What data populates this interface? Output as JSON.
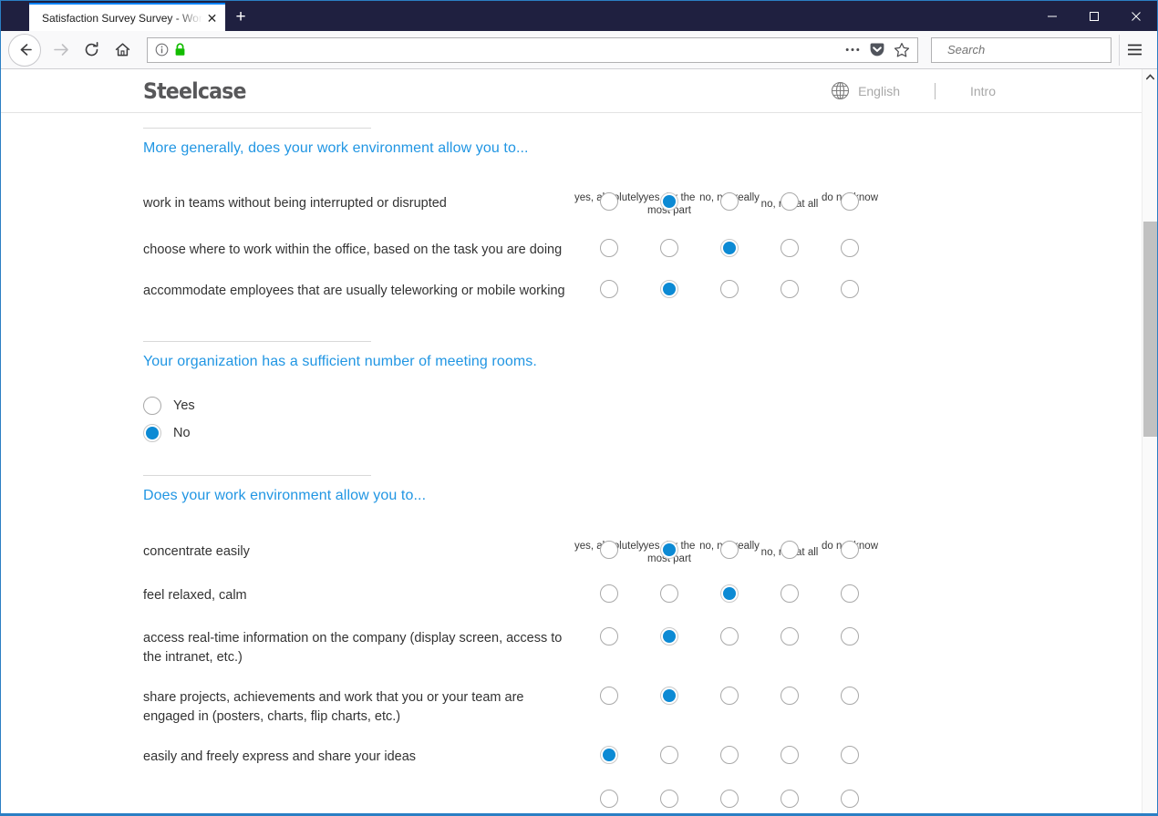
{
  "browser": {
    "tab_title": "Satisfaction Survey Survey - Workpl",
    "tab_close_glyph": "✕",
    "new_tab_glyph": "+",
    "url_value": "",
    "search_placeholder": "Search",
    "search_value": ""
  },
  "site": {
    "logo_text": "Steelcase",
    "language_label": "English",
    "intro_label": "Intro"
  },
  "colors": {
    "accent_blue": "#2196e3",
    "radio_fill": "#0c8ad4",
    "titlebar": "#1f2040",
    "window_border": "#2b7fc4",
    "logo_gray": "#58585a",
    "muted_gray": "#a8a8a8"
  },
  "scale_options": [
    "yes, absolutely",
    "yes, for the most part",
    "no, not really",
    "no, not at all",
    "do not know"
  ],
  "sections": [
    {
      "id": "more-generally",
      "type": "matrix",
      "title": "More generally, does your work environment allow you to...",
      "rows": [
        {
          "label": "work in teams without being interrupted or disrupted",
          "selected": 1
        },
        {
          "label": "choose where to work within the office, based on the task you are doing",
          "selected": 2
        },
        {
          "label": "accommodate employees that are usually teleworking or mobile working",
          "selected": 1
        }
      ]
    },
    {
      "id": "meeting-rooms",
      "type": "yesno",
      "title": "Your organization has a sufficient number of meeting rooms.",
      "options": [
        {
          "label": "Yes",
          "selected": false
        },
        {
          "label": "No",
          "selected": true
        }
      ]
    },
    {
      "id": "does-allow",
      "type": "matrix",
      "title": "Does your work environment allow you to...",
      "rows": [
        {
          "label": "concentrate easily",
          "selected": 1
        },
        {
          "label": "feel relaxed, calm",
          "selected": 2
        },
        {
          "label": "access real-time information on the company (display screen, access to the intranet, etc.)",
          "selected": 1
        },
        {
          "label": "share projects, achievements and work that you or your team are engaged in (posters, charts, flip charts, etc.)",
          "selected": 1
        },
        {
          "label": "easily and freely express and share your ideas",
          "selected": 0
        },
        {
          "label": "",
          "selected": -1
        }
      ]
    }
  ]
}
